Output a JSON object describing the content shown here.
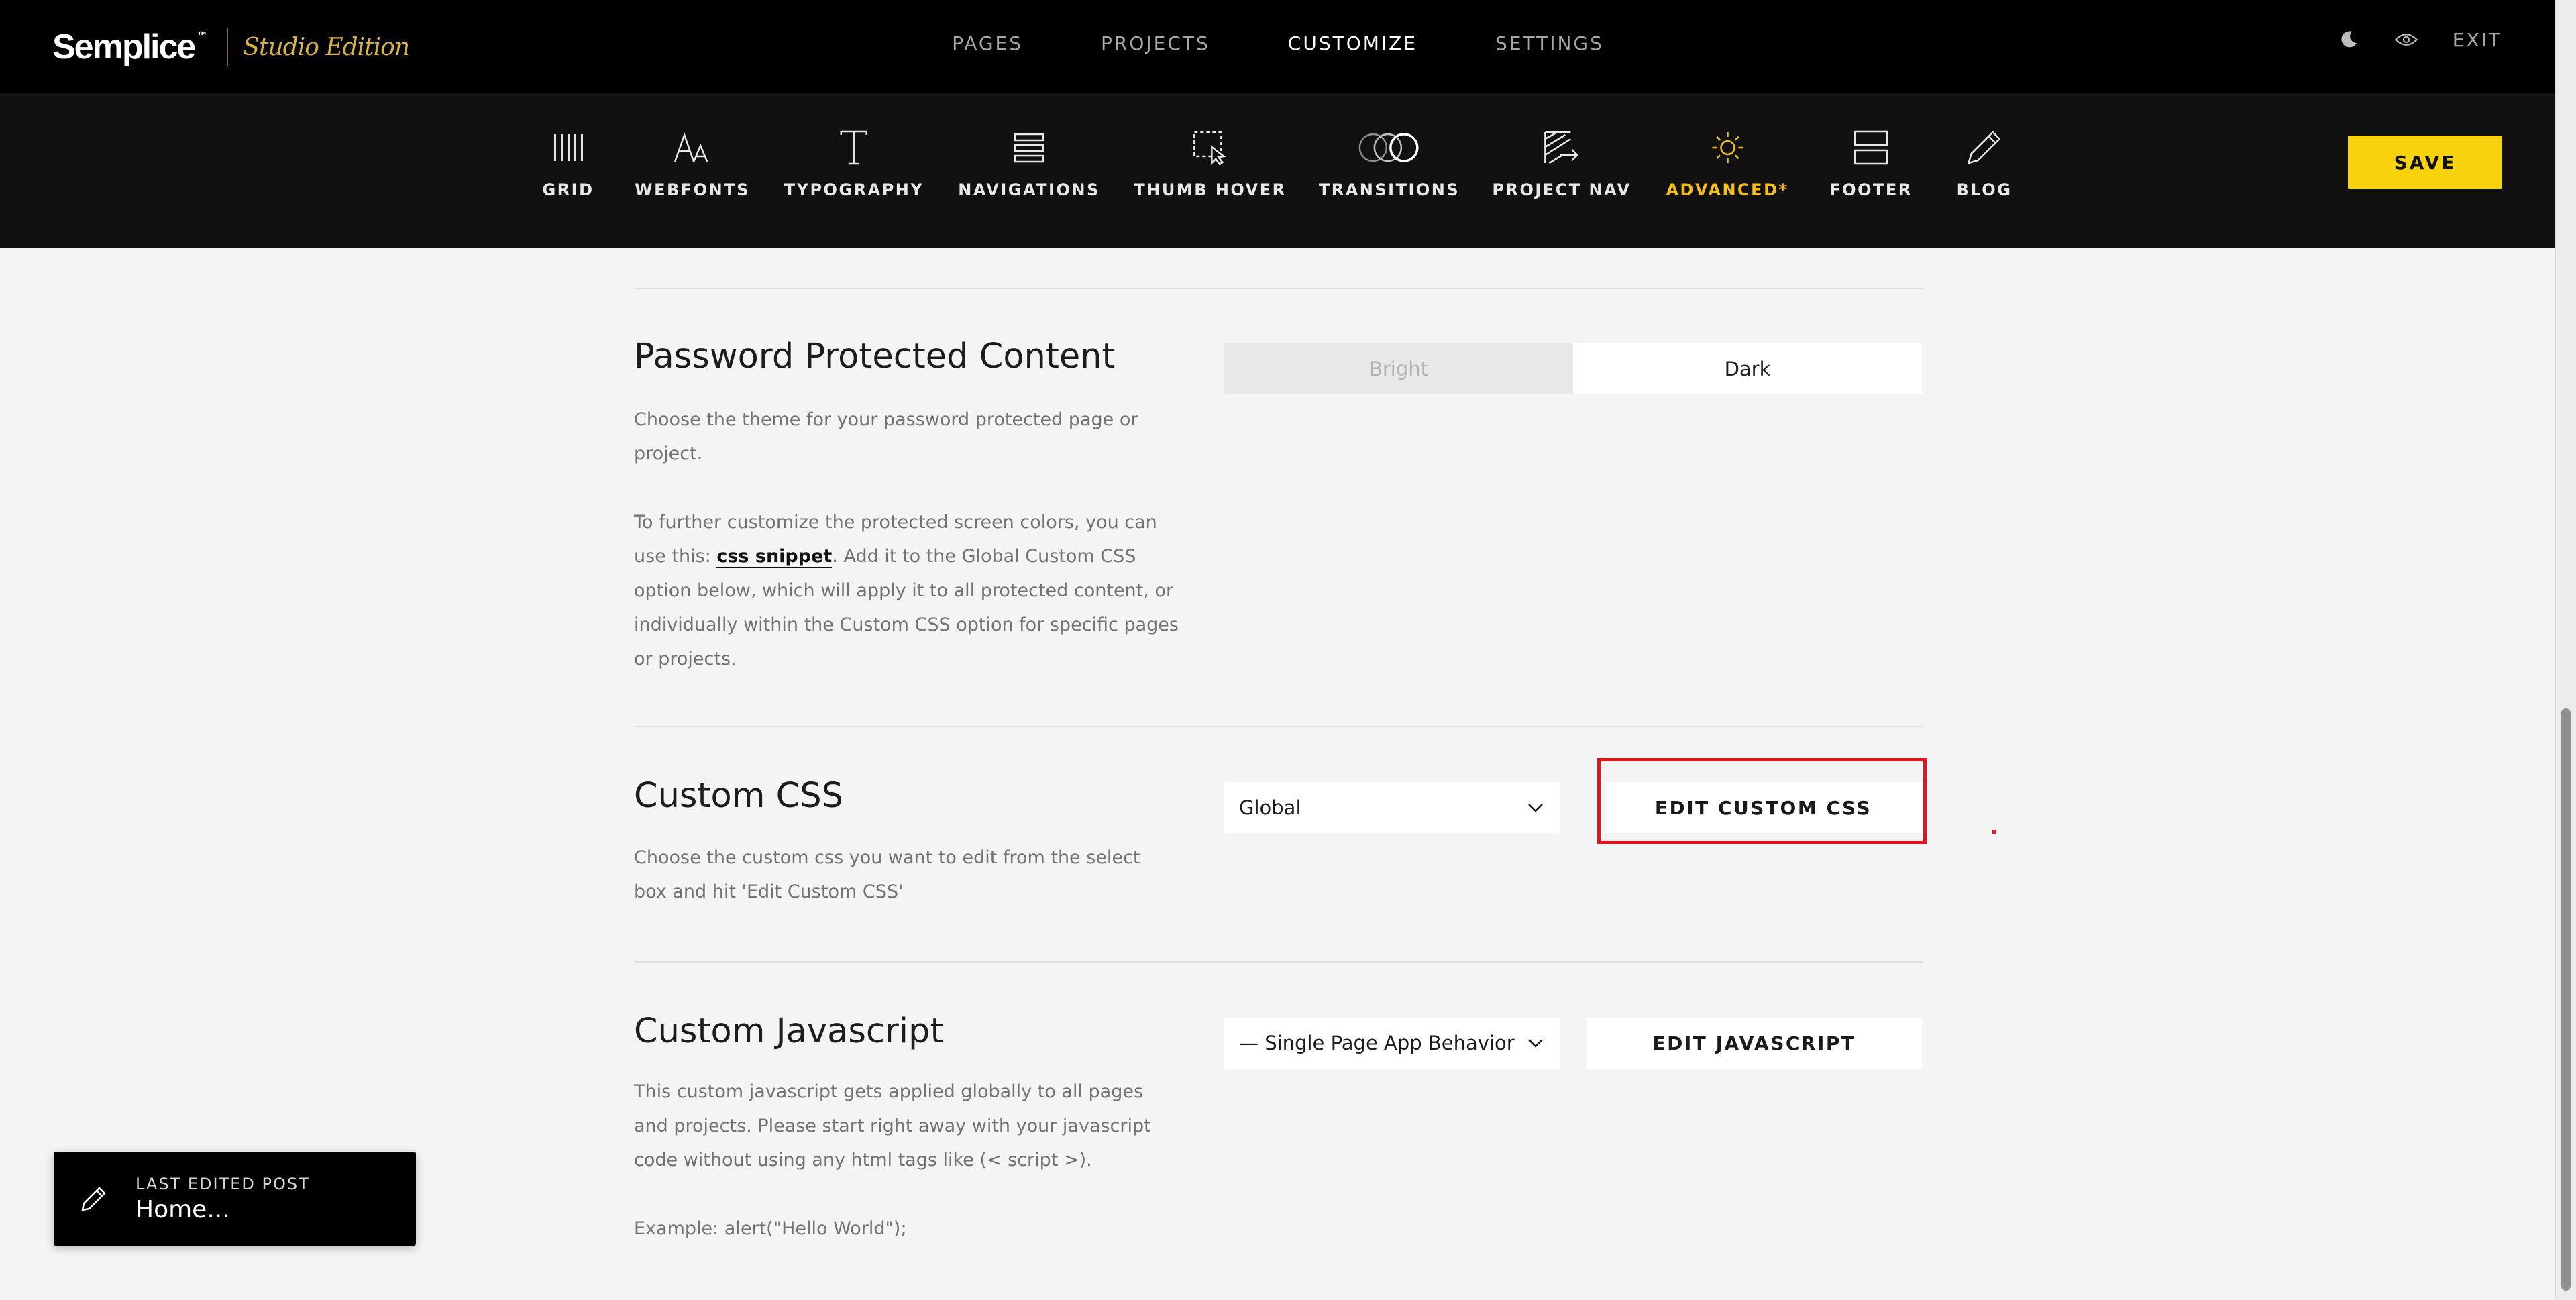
{
  "brand": {
    "name": "Semplice",
    "tm": "™",
    "edition": "Studio Edition"
  },
  "main_nav": [
    {
      "label": "PAGES",
      "active": false
    },
    {
      "label": "PROJECTS",
      "active": false
    },
    {
      "label": "CUSTOMIZE",
      "active": true
    },
    {
      "label": "SETTINGS",
      "active": false
    }
  ],
  "top_right": {
    "exit_label": "EXIT",
    "moon_icon": "moon-icon",
    "preview_icon": "eye-icon"
  },
  "toolbar": {
    "items": [
      {
        "label": "GRID",
        "icon": "grid-icon"
      },
      {
        "label": "WEBFONTS",
        "icon": "webfonts-icon"
      },
      {
        "label": "TYPOGRAPHY",
        "icon": "typography-icon"
      },
      {
        "label": "NAVIGATIONS",
        "icon": "navigations-icon"
      },
      {
        "label": "THUMB HOVER",
        "icon": "thumb-hover-icon"
      },
      {
        "label": "TRANSITIONS",
        "icon": "transitions-icon"
      },
      {
        "label": "PROJECT NAV",
        "icon": "project-nav-icon"
      },
      {
        "label": "ADVANCED*",
        "icon": "sun-icon",
        "active": true
      },
      {
        "label": "FOOTER",
        "icon": "footer-icon"
      },
      {
        "label": "BLOG",
        "icon": "pencil-icon"
      }
    ],
    "save_label": "SAVE",
    "accent_color": "#F8D20C"
  },
  "sections": {
    "password": {
      "title": "Password Protected Content",
      "desc1": "Choose the theme for your password protected page or project.",
      "desc2_prefix": "To further customize the protected screen colors, you can use this: ",
      "desc2_link": "css snippet",
      "desc2_suffix": ". Add it to the Global Custom CSS option below, which will apply it to all protected content, or individually within the Custom CSS option for specific pages or projects.",
      "theme_options": [
        "Bright",
        "Dark"
      ],
      "selected_theme": "Dark"
    },
    "custom_css": {
      "title": "Custom CSS",
      "desc": "Choose the custom css you want to edit from the select box and hit 'Edit Custom CSS'",
      "select_value": "Global",
      "button_label": "EDIT CUSTOM CSS"
    },
    "custom_js": {
      "title": "Custom Javascript",
      "desc1": "This custom javascript gets applied globally to all pages and projects. Please start right away with your javascript code without using any html tags like (< script >).",
      "desc2": "Example: alert(\"Hello World\");",
      "select_value": "— Single Page App Behavior",
      "button_label": "EDIT JAVASCRIPT"
    }
  },
  "last_edited": {
    "label": "LAST EDITED POST",
    "value": "Home..."
  },
  "highlight_color": "#E0161C"
}
